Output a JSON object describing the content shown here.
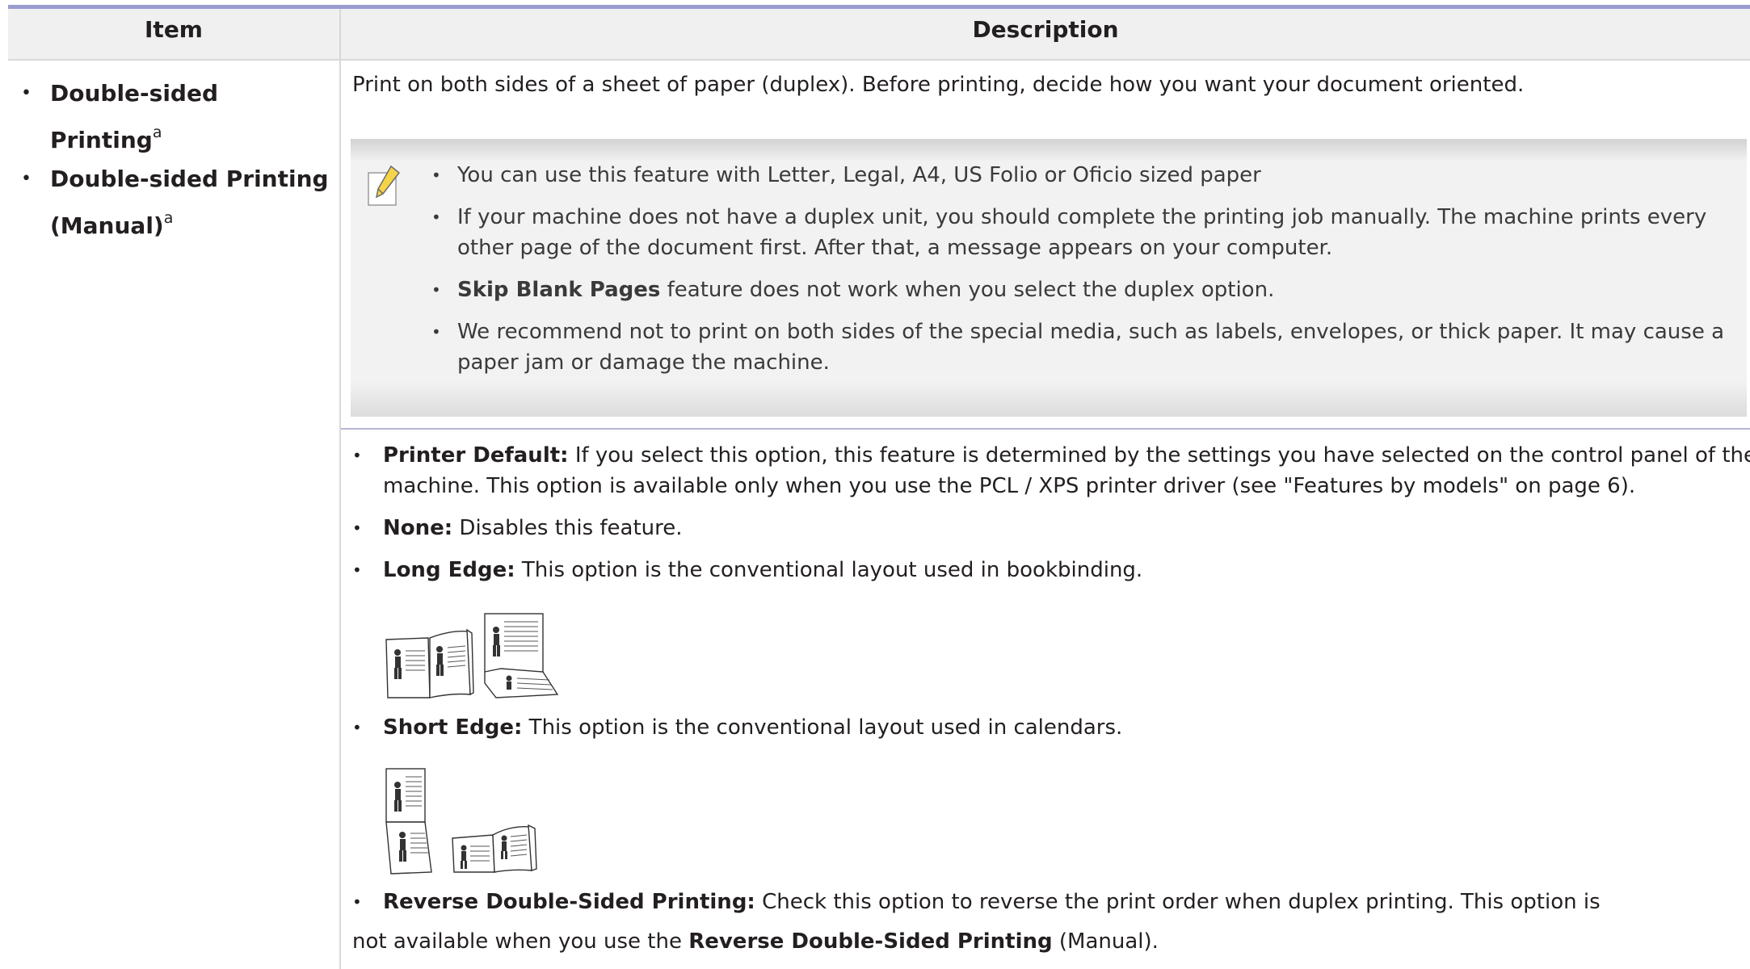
{
  "table": {
    "header_item": "Item",
    "header_description": "Description"
  },
  "left": {
    "items": [
      {
        "label": "Double-sided Printing",
        "sup": "a"
      },
      {
        "label": "Double-sided Printing (Manual)",
        "sup": "a"
      }
    ]
  },
  "description": {
    "intro": "Print on both sides of a sheet of paper (duplex). Before printing, decide how you want your document oriented.",
    "note_icon": "note-pencil-icon",
    "notes": [
      {
        "text": "You can use this feature with Letter, Legal, A4, US Folio or Oficio sized paper"
      },
      {
        "text": "If your machine does not have a duplex unit, you should complete the printing job manually. The machine prints every other page of the document first. After that, a message appears on your computer."
      },
      {
        "bold": "Skip Blank Pages",
        "text": " feature does not work when you select the duplex option."
      },
      {
        "text": "We recommend not to print on both sides of the special media, such as labels, envelopes, or thick paper. It may cause a paper jam or damage the machine."
      }
    ],
    "options": [
      {
        "bold": "Printer Default:",
        "text": " If you select this option, this feature is determined by the settings you have selected on the control panel of the machine. This option is available only when you use the PCL / XPS printer driver (see \"Features by models\" on page 6)."
      },
      {
        "bold": "None:",
        "text": " Disables this feature."
      },
      {
        "bold": "Long Edge:",
        "text": " This option is the conventional layout used in bookbinding."
      },
      {
        "bold": "Short Edge:",
        "text": " This option is the conventional layout used in calendars."
      },
      {
        "bold": "Reverse Double-Sided Printing:",
        "text": " Check this option to reverse the print order when duplex printing. This option is"
      }
    ],
    "trailing_pre": "not available when you use the ",
    "trailing_bold": "Reverse Double-Sided Printing",
    "trailing_post": " (Manual)."
  },
  "illustrations": {
    "long_edge": "long-edge-duplex-illustration",
    "short_edge": "short-edge-duplex-illustration"
  },
  "colors": {
    "top_rule": "#9b9bd0",
    "header_bg": "#f0f0f0",
    "note_bg": "#f2f2f2",
    "separator": "#b6b6d8"
  }
}
